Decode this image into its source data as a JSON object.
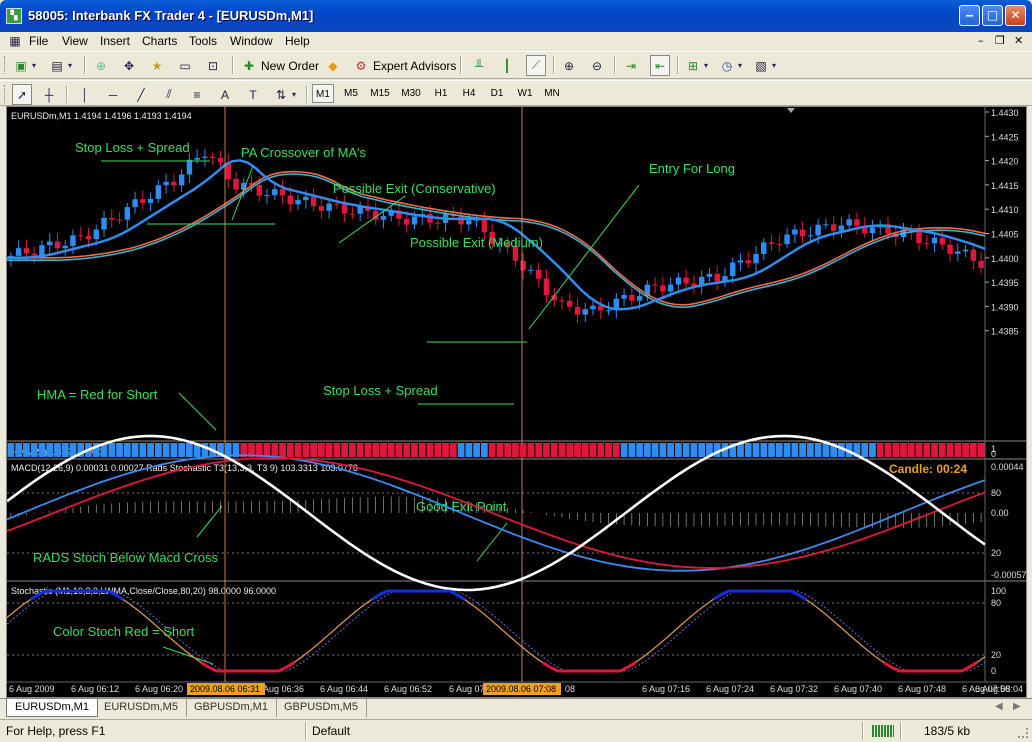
{
  "window": {
    "title": "58005: Interbank FX Trader 4 - [EURUSDm,M1]"
  },
  "menu": [
    "File",
    "View",
    "Insert",
    "Charts",
    "Tools",
    "Window",
    "Help"
  ],
  "toolbar": {
    "new_order": "New Order",
    "expert_advisors": "Expert Advisors"
  },
  "periods": [
    "M1",
    "M5",
    "M15",
    "M30",
    "H1",
    "H4",
    "D1",
    "W1",
    "MN"
  ],
  "active_period": "M1",
  "chart": {
    "main_header": "EURUSDm,M1 1.4194 1.4196 1.4193 1.4194",
    "hma_header": "HMA(24) 1.4191 1.0000",
    "macd_header": "MACD(12,26,9) 0.00031 0.00027 Rads Stochastic T3(13,3,3, T3 9) 103.3313 103.0778",
    "candle_timer": "Candle:  00:24",
    "stoch_header": "Stochastic (M1,10,3,3,LWMA,Close/Close,80,20) 98.0000 96.0000",
    "price_axis": [
      "1.4430",
      "1.4425",
      "1.4420",
      "1.4415",
      "1.4410",
      "1.4405",
      "1.4400",
      "1.4395",
      "1.4390",
      "1.4385"
    ],
    "hma_axis": [
      "1",
      "0"
    ],
    "macd_axis": [
      "0.00044",
      "80",
      "0.00",
      "20",
      "-0.00057"
    ],
    "stoch_axis": [
      "100",
      "80",
      "20",
      "0"
    ],
    "time_axis": [
      "6 Aug 2009",
      "6 Aug 06:12",
      "6 Aug 06:20",
      "6 Aug 06:36",
      "6 Aug 06:44",
      "6 Aug 06:52",
      "6 Aug 07:00",
      "6 Aug 07:16",
      "6 Aug 07:24",
      "6 Aug 07:32",
      "6 Aug 07:40",
      "6 Aug 07:48",
      "6 Aug 07:56",
      "6 Aug 08:04"
    ],
    "time_axis_tail": [
      "08"
    ],
    "crosshair_labels": [
      "2009.08.06 06:31",
      "2009.08.06 07:08"
    ],
    "annotations": {
      "stop_loss_top": "Stop Loss + Spread",
      "pa_crossover": "PA Crossover of MA's",
      "possible_exit_cons": "Possible Exit (Conservative)",
      "possible_exit_med": "Possible Exit (Medium)",
      "entry_long": "Entry For Long",
      "stop_loss_bottom": "Stop Loss + Spread",
      "hma_red": "HMA = Red for Short",
      "good_exit": "Good Exit Point",
      "rads_stoch": "RADS Stoch Below Macd Cross",
      "color_stoch": "Color Stoch Red = Short"
    }
  },
  "tabs": [
    "EURUSDm,M1",
    "EURUSDm,M5",
    "GBPUSDm,M1",
    "GBPUSDm,M5"
  ],
  "active_tab": "EURUSDm,M1",
  "status": {
    "help": "For Help, press F1",
    "profile": "Default",
    "traffic": "183/5 kb"
  },
  "colors": {
    "bull": "#2F8CF0",
    "bear": "#E0163C",
    "annotation": "#33E05A",
    "hma_slow": "#3EC8E8",
    "ma_slow": "#F06A4A"
  }
}
